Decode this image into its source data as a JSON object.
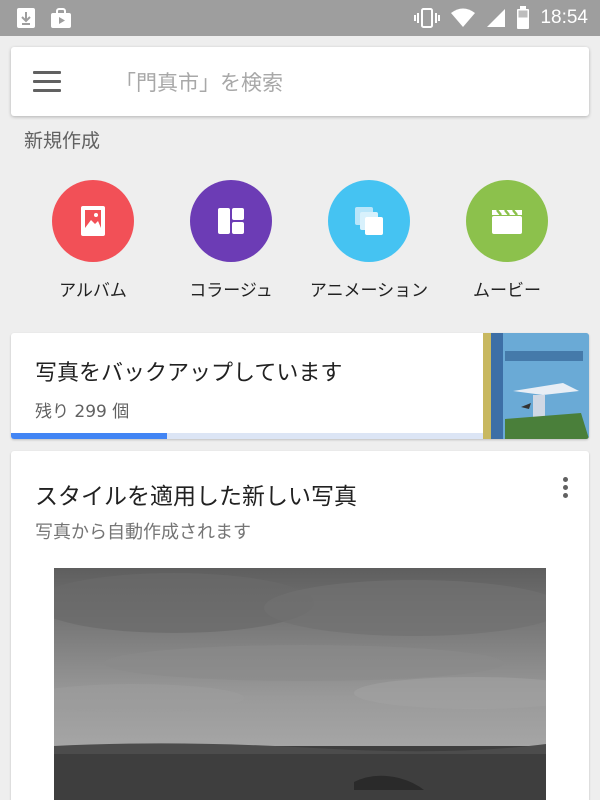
{
  "status_bar": {
    "time": "18:54",
    "left_icons": [
      "download-icon",
      "store-bag-icon"
    ],
    "right_icons": [
      "vibrate-icon",
      "wifi-icon",
      "signal-icon",
      "battery-icon"
    ]
  },
  "search": {
    "placeholder": "「門真市」を検索"
  },
  "new_section": {
    "heading": "新規作成",
    "items": [
      {
        "label": "アルバム",
        "icon": "album-icon",
        "color": "#f25057"
      },
      {
        "label": "コラージュ",
        "icon": "collage-icon",
        "color": "#6c3cb5"
      },
      {
        "label": "アニメーション",
        "icon": "animation-icon",
        "color": "#45c3f2"
      },
      {
        "label": "ムービー",
        "icon": "movie-icon",
        "color": "#8cc14c"
      }
    ]
  },
  "backup_card": {
    "title": "写真をバックアップしています",
    "subtitle": "残り 299 個",
    "progress": 0.33,
    "progress_color": "#4285f4"
  },
  "style_card": {
    "title": "スタイルを適用した新しい写真",
    "subtitle": "写真から自動作成されます"
  },
  "colors": {
    "background": "#eeeeee",
    "status_bar": "#9e9e9e",
    "accent": "#4285f4"
  }
}
